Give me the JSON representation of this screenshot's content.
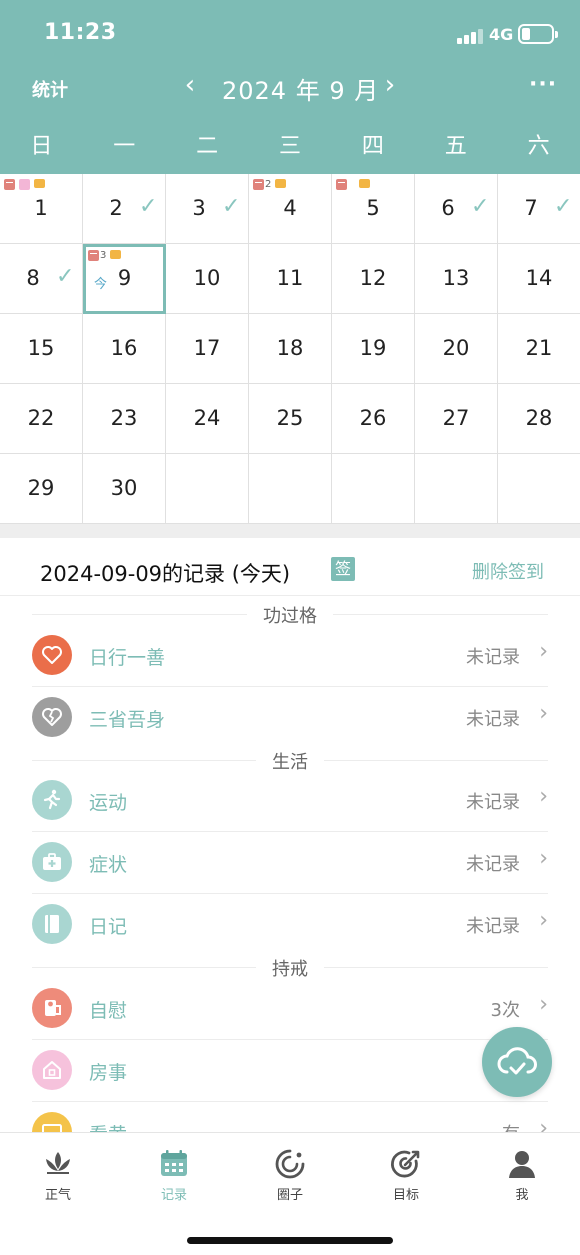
{
  "status": {
    "time": "11:23",
    "network": "4G"
  },
  "header": {
    "stats_label": "统计",
    "prev": "‹",
    "month_title": "2024 年 9 月",
    "next": "›",
    "more": "···"
  },
  "weekdays": [
    "日",
    "一",
    "二",
    "三",
    "四",
    "五",
    "六"
  ],
  "calendar": {
    "days": [
      "1",
      "2",
      "3",
      "4",
      "5",
      "6",
      "7",
      "8",
      "9",
      "10",
      "11",
      "12",
      "13",
      "14",
      "15",
      "16",
      "17",
      "18",
      "19",
      "20",
      "21",
      "22",
      "23",
      "24",
      "25",
      "26",
      "27",
      "28",
      "29",
      "30"
    ],
    "check": "✓",
    "today_tag": "今",
    "mark_count_4": "2",
    "mark_count_9": "3"
  },
  "record": {
    "title": "2024-09-09的记录 (今天)",
    "sign_badge": "签",
    "delete_label": "删除签到",
    "sections": {
      "merit": "功过格",
      "life": "生活",
      "precepts": "持戒"
    },
    "rows": {
      "good_deed": {
        "label": "日行一善",
        "value": "未记录"
      },
      "reflect": {
        "label": "三省吾身",
        "value": "未记录"
      },
      "exercise": {
        "label": "运动",
        "value": "未记录"
      },
      "symptom": {
        "label": "症状",
        "value": "未记录"
      },
      "diary": {
        "label": "日记",
        "value": "未记录"
      },
      "masturbation": {
        "label": "自慰",
        "value": "3次"
      },
      "intimacy": {
        "label": "房事",
        "value": ""
      },
      "watch": {
        "label": "看黄",
        "value": "有"
      }
    },
    "chevron": "›"
  },
  "tabs": [
    {
      "label": "正气",
      "icon": "lotus-icon"
    },
    {
      "label": "记录",
      "icon": "calendar-icon"
    },
    {
      "label": "圈子",
      "icon": "circle-icon"
    },
    {
      "label": "目标",
      "icon": "target-icon"
    },
    {
      "label": "我",
      "icon": "person-icon"
    }
  ],
  "colors": {
    "accent": "#7dbcb5",
    "heart": "#ea6e4a",
    "broken_heart": "#9e9e9e",
    "soft_teal": "#a9d6d1",
    "salmon": "#ee8b7a",
    "pink": "#f6c2dc",
    "yellow": "#f4c34a"
  }
}
